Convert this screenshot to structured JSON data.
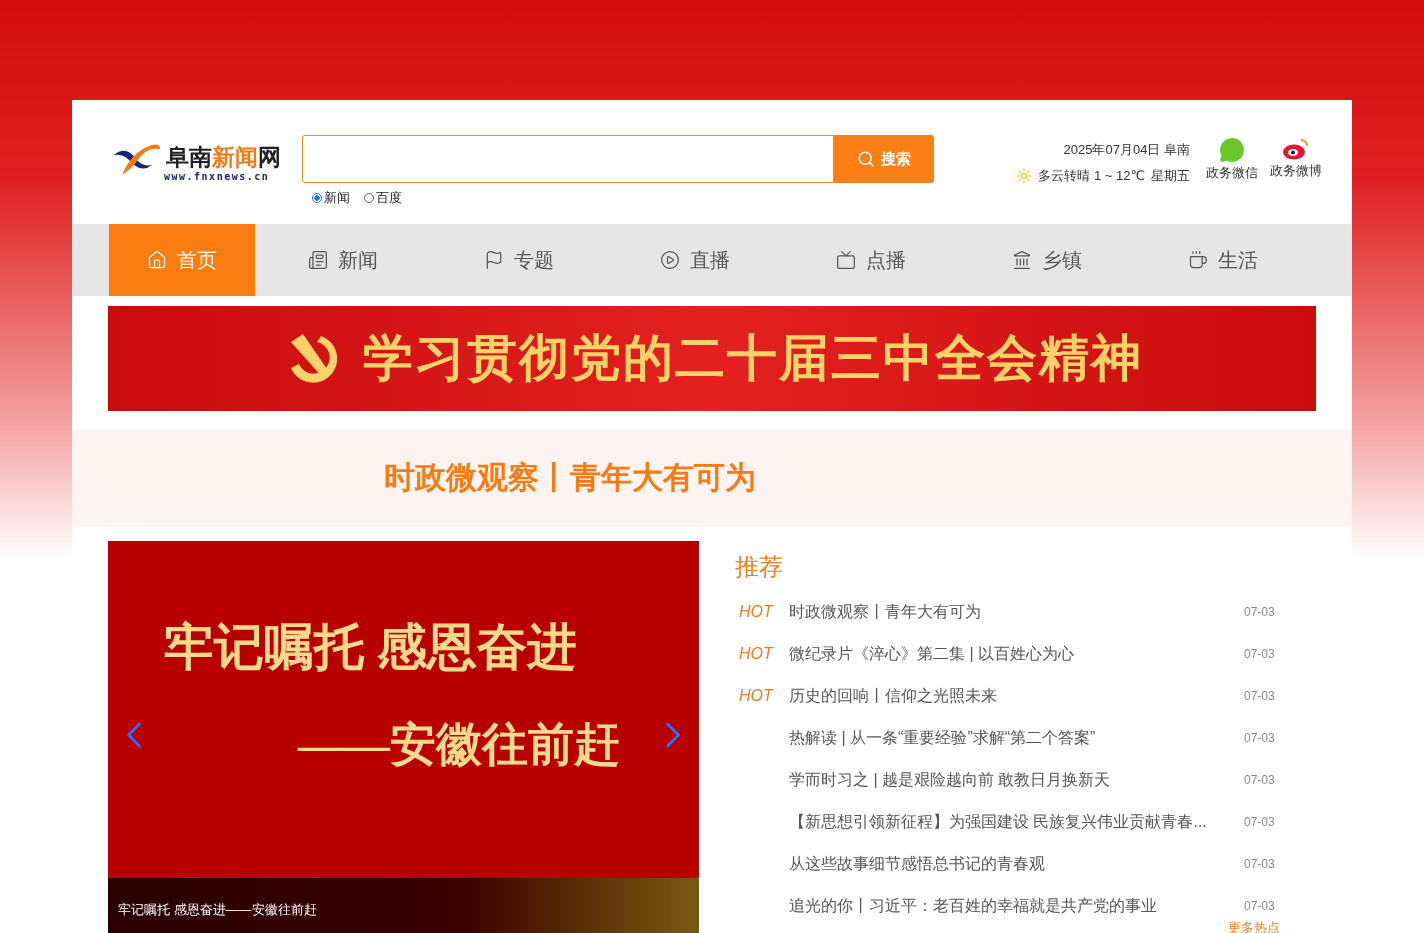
{
  "header": {
    "logo": {
      "name": "阜南",
      "accent": "新闻",
      "tail": "网",
      "url": "www.fnxnews.cn"
    },
    "search": {
      "button": "搜索",
      "options": [
        {
          "label": "新闻",
          "selected": true
        },
        {
          "label": "百度",
          "selected": false
        }
      ]
    },
    "date": "2025年07月04日 阜南",
    "weather": "多云转晴 1 ~ 12℃",
    "weekday": "星期五",
    "social": [
      {
        "kind": "wechat",
        "label": "政务微信"
      },
      {
        "kind": "weibo",
        "label": "政务微博"
      }
    ]
  },
  "nav": [
    {
      "label": "首页",
      "kind": "home",
      "selected": true
    },
    {
      "label": "新闻",
      "kind": "news",
      "selected": false
    },
    {
      "label": "专题",
      "kind": "topic",
      "selected": false
    },
    {
      "label": "直播",
      "kind": "live",
      "selected": false
    },
    {
      "label": "点播",
      "kind": "vod",
      "selected": false
    },
    {
      "label": "乡镇",
      "kind": "town",
      "selected": false
    },
    {
      "label": "生活",
      "kind": "life",
      "selected": false
    }
  ],
  "banner": {
    "text": "学习贯彻党的二十届三中全会精神"
  },
  "headline": {
    "text": "时政微观察丨青年大有可为"
  },
  "slider": {
    "lines": [
      "牢记嘱托  感恩奋进",
      "——安徽往前赶"
    ],
    "caption": "牢记嘱托 感恩奋进——安徽往前赶"
  },
  "recommend": {
    "title": "推荐",
    "items": [
      {
        "badge": "HOT",
        "title": "时政微观察丨青年大有可为",
        "date": "07-03"
      },
      {
        "badge": "HOT",
        "title": "微纪录片《淬心》第二集 | 以百姓心为心",
        "date": "07-03"
      },
      {
        "badge": "HOT",
        "title": "历史的回响丨信仰之光照未来",
        "date": "07-03"
      },
      {
        "title": "热解读 | 从一条“重要经验”求解“第二个答案”",
        "date": "07-03"
      },
      {
        "title": "学而时习之 | 越是艰险越向前 敢教日月换新天",
        "date": "07-03"
      },
      {
        "title": "【新思想引领新征程】为强国建设 民族复兴伟业贡献青春...",
        "date": "07-03"
      },
      {
        "title": "从这些故事细节感悟总书记的青春观",
        "date": "07-03"
      },
      {
        "title": "追光的你丨习近平：老百姓的幸福就是共产党的事业",
        "date": "07-03"
      }
    ],
    "more": "更多热点"
  }
}
